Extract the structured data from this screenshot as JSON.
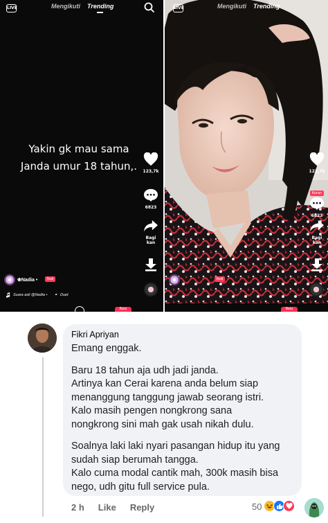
{
  "left_panel": {
    "tabs": {
      "following": "Mengikuti",
      "trending": "Trending"
    },
    "caption_line1": "Yakin gk mau sama",
    "caption_line2": "Janda umur 18 tahun,.",
    "like_count": "123,7k",
    "comment_count": "6823",
    "share_label_1": "Bagi",
    "share_label_2": "kan",
    "username": "❀Nadia •",
    "follow_badge": "Ikuti",
    "sound_text": "Suara asli @Nadia •",
    "duet_label": "Duet",
    "bottom_badge": "Baru"
  },
  "right_panel": {
    "tabs": {
      "following": "Mengikuti",
      "trending": "Trending"
    },
    "like_count": "123,7k",
    "comment_count": "6823",
    "comment_badge": "Koran",
    "share_label_1": "Bagi",
    "share_label_2": "kan",
    "follow_badge": "Ikuti",
    "bottom_badge": "Baru"
  },
  "icons": {
    "live": "LIVE",
    "search": "search-icon",
    "like": "heart-icon",
    "comment": "comment-bubble-icon",
    "share": "share-arrow-icon",
    "download": "download-icon",
    "music": "music-note-icon"
  },
  "comment": {
    "author": "Fikri Apriyan",
    "line_intro": "Emang enggak.",
    "para2": [
      "Baru 18 tahun aja udh jadi janda.",
      "Artinya kan Cerai karena anda belum siap",
      "menanggung tanggung jawab seorang istri.",
      "Kalo masih pengen nongkrong sana",
      "nongkrong sini mah gak usah nikah dulu."
    ],
    "para3": [
      "Soalnya laki laki nyari pasangan hidup itu yang",
      "sudah siap berumah tangga.",
      "Kalo cuma modal cantik mah, 300k masih bisa",
      "nego, udh gitu full service pula."
    ],
    "time": "2 h",
    "like_action": "Like",
    "reply_action": "Reply",
    "reaction_count": "50"
  },
  "colors": {
    "tiktok_red": "#ff3b5c",
    "bubble_bg": "#f0f2f5",
    "meta_text": "#65676b"
  }
}
